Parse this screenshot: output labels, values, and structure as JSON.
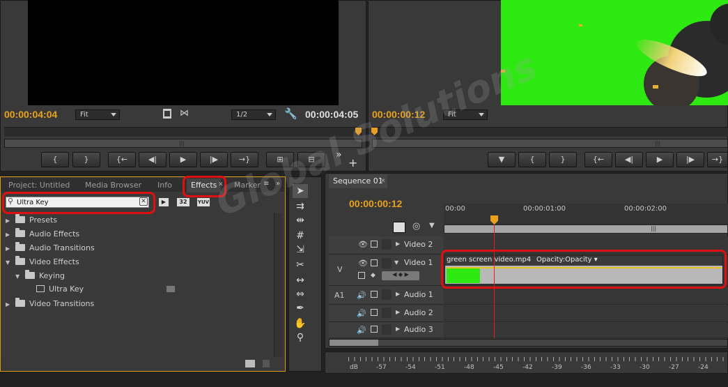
{
  "source_monitor": {
    "timecode_in": "00:00:04:04",
    "fit_label": "Fit",
    "resolution_label": "1/2",
    "timecode_out": "00:00:04:05"
  },
  "program_monitor": {
    "timecode": "00:00:00:12",
    "fit_label": "Fit"
  },
  "transport": {
    "mark_in": "{",
    "mark_out": "}",
    "go_in": "{←",
    "step_back": "◀|",
    "play": "▶",
    "step_fwd": "|▶",
    "go_out": "→}",
    "more": "»",
    "add": "+"
  },
  "project_panel": {
    "tabs": [
      "Project: Untitled",
      "Media Browser",
      "Info",
      "Effects",
      "Marker"
    ],
    "active_tab": "Effects",
    "search_value": "Ultra Key",
    "badge_32": "32",
    "badge_yuv": "YUV",
    "tree": [
      {
        "label": "Presets",
        "level": 0,
        "expanded": false,
        "type": "folder"
      },
      {
        "label": "Audio Effects",
        "level": 0,
        "expanded": false,
        "type": "folder"
      },
      {
        "label": "Audio Transitions",
        "level": 0,
        "expanded": false,
        "type": "folder"
      },
      {
        "label": "Video Effects",
        "level": 0,
        "expanded": true,
        "type": "folder"
      },
      {
        "label": "Keying",
        "level": 1,
        "expanded": true,
        "type": "folder"
      },
      {
        "label": "Ultra Key",
        "level": 2,
        "expanded": false,
        "type": "effect"
      },
      {
        "label": "Video Transitions",
        "level": 0,
        "expanded": false,
        "type": "folder"
      }
    ]
  },
  "sequence": {
    "tab_label": "Sequence 01",
    "timecode": "00:00:00:12",
    "ruler_labels": [
      "00:00",
      "00:00:01:00",
      "00:00:02:00"
    ],
    "tracks": {
      "video2": "Video 2",
      "video1": "Video 1",
      "v_label": "V",
      "a1_label": "A1",
      "audio1": "Audio 1",
      "audio2": "Audio 2",
      "audio3": "Audio 3"
    },
    "clip_name": "green screen video.mp4",
    "clip_property": "Opacity:Opacity"
  },
  "audio_meter": {
    "labels": [
      "dB",
      "-57",
      "-54",
      "-51",
      "-48",
      "-45",
      "-42",
      "-39",
      "-36",
      "-33",
      "-30",
      "-27",
      "-24"
    ]
  },
  "watermark": "Global Solutions",
  "colors": {
    "timecode": "#e9a21a",
    "green_screen": "#2ee812",
    "highlight": "#e01010",
    "playhead": "#e8a020"
  }
}
